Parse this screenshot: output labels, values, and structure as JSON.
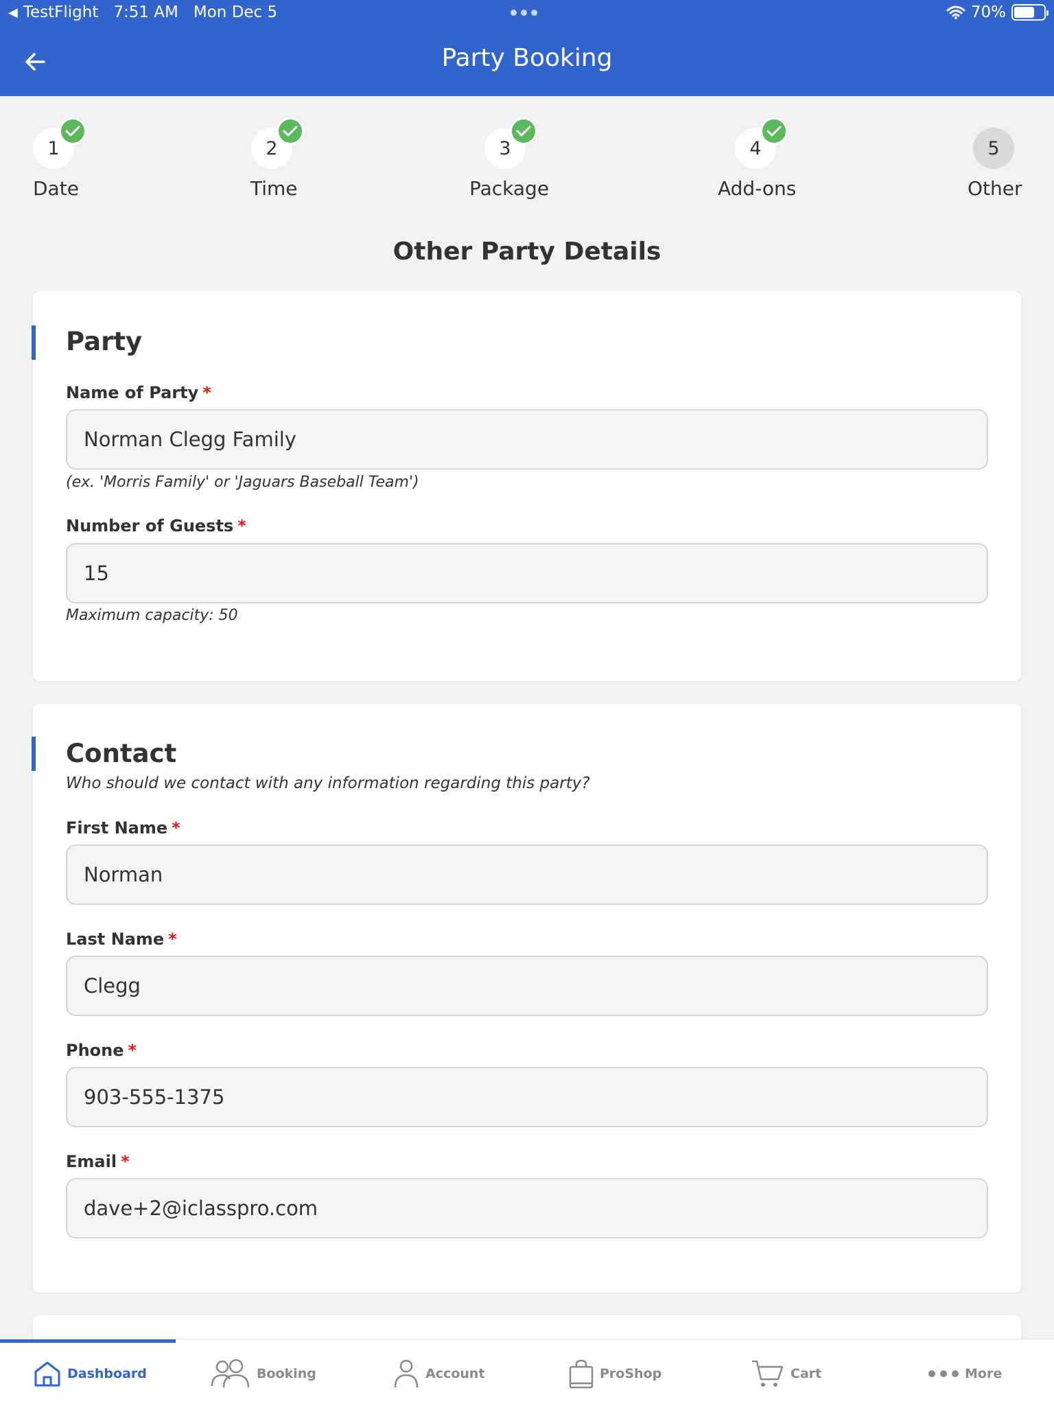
{
  "status_bar": {
    "app": "TestFlight",
    "time": "7:51 AM",
    "date": "Mon Dec 5",
    "battery": "70%",
    "battery_level": 0.7
  },
  "header": {
    "title": "Party Booking",
    "back_icon": "arrow-left-icon"
  },
  "steps": [
    {
      "number": "1",
      "label": "Date",
      "done": true
    },
    {
      "number": "2",
      "label": "Time",
      "done": true
    },
    {
      "number": "3",
      "label": "Package",
      "done": true
    },
    {
      "number": "4",
      "label": "Add-ons",
      "done": true
    },
    {
      "number": "5",
      "label": "Other",
      "done": false
    }
  ],
  "page_title": "Other Party Details",
  "party": {
    "heading": "Party",
    "name_label": "Name of Party",
    "name_value": "Norman Clegg Family",
    "name_hint": "(ex. 'Morris Family' or 'Jaguars Baseball Team')",
    "guests_label": "Number of Guests",
    "guests_value": "15",
    "guests_hint": "Maximum capacity: 50"
  },
  "contact": {
    "heading": "Contact",
    "subtitle": "Who should we contact with any information regarding this party?",
    "first_label": "First Name",
    "first_value": "Norman",
    "last_label": "Last Name",
    "last_value": "Clegg",
    "phone_label": "Phone",
    "phone_value": "903-555-1375",
    "email_label": "Email",
    "email_value": "dave+2@iclasspro.com"
  },
  "required_mark": "*",
  "nav": [
    {
      "label": "Dashboard",
      "icon": "home-icon",
      "active": true
    },
    {
      "label": "Booking",
      "icon": "users-icon",
      "active": false
    },
    {
      "label": "Account",
      "icon": "user-icon",
      "active": false
    },
    {
      "label": "ProShop",
      "icon": "shopping-bag-icon",
      "active": false
    },
    {
      "label": "Cart",
      "icon": "cart-icon",
      "active": false
    },
    {
      "label": "More",
      "icon": "more-dots-icon",
      "active": false
    }
  ],
  "colors": {
    "primary": "#3164cd",
    "success": "#5cb85c",
    "required": "#e31b1b"
  }
}
